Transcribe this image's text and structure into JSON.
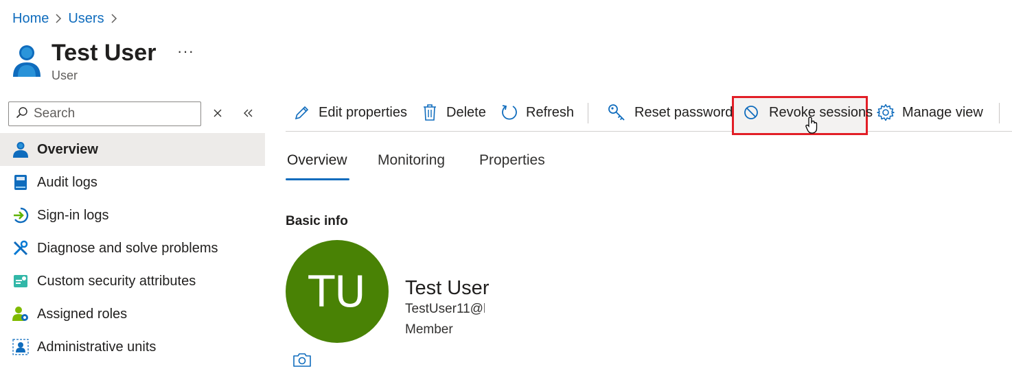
{
  "breadcrumb": {
    "items": [
      "Home",
      "Users"
    ]
  },
  "header": {
    "title": "Test User",
    "subtitle": "User",
    "more_label": "···"
  },
  "sidebar": {
    "search_placeholder": "Search",
    "items": [
      {
        "label": "Overview",
        "icon": "user-icon",
        "active": true
      },
      {
        "label": "Audit logs",
        "icon": "book-icon"
      },
      {
        "label": "Sign-in logs",
        "icon": "sign-in-icon"
      },
      {
        "label": "Diagnose and solve problems",
        "icon": "wrench-icon"
      },
      {
        "label": "Custom security attributes",
        "icon": "attributes-icon"
      },
      {
        "label": "Assigned roles",
        "icon": "roles-icon"
      },
      {
        "label": "Administrative units",
        "icon": "admin-units-icon"
      }
    ]
  },
  "toolbar": {
    "edit_label": "Edit properties",
    "delete_label": "Delete",
    "refresh_label": "Refresh",
    "reset_password_label": "Reset password",
    "revoke_sessions_label": "Revoke sessions",
    "manage_view_label": "Manage view"
  },
  "tabs": [
    "Overview",
    "Monitoring",
    "Properties"
  ],
  "basic_info": {
    "title": "Basic info",
    "initials": "TU",
    "name": "Test User",
    "email": "TestUser11@l",
    "type": "Member"
  },
  "colors": {
    "accent": "#0f6cbd",
    "avatar": "#498205",
    "highlight": "#e21e26"
  }
}
